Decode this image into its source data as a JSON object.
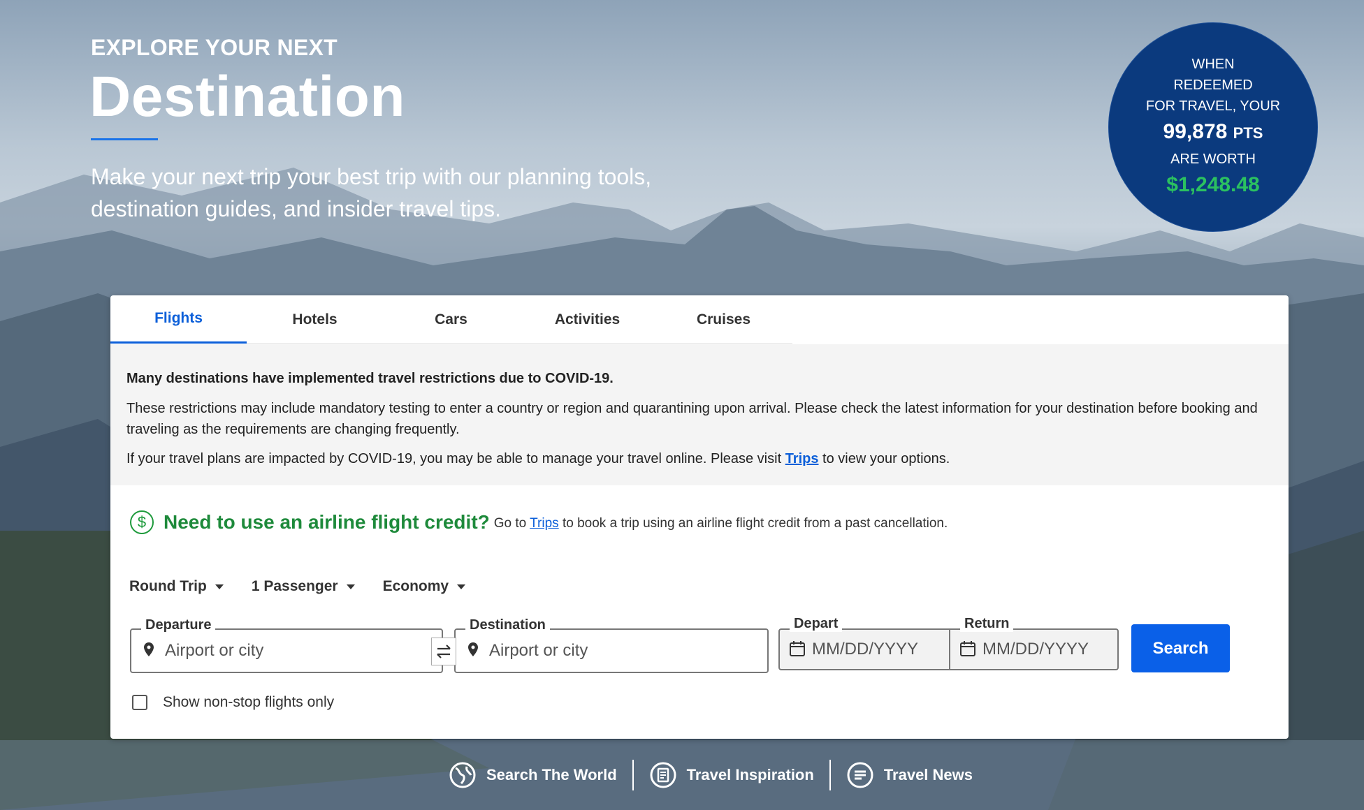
{
  "hero": {
    "kicker": "EXPLORE YOUR NEXT",
    "title": "Destination",
    "subtitle_line1": "Make your next trip your best trip with our planning tools,",
    "subtitle_line2": "destination guides, and insider travel tips."
  },
  "badge": {
    "line1": "WHEN",
    "line2": "REDEEMED",
    "line3": "FOR TRAVEL, YOUR",
    "points": "99,878",
    "points_unit": "PTS",
    "line4": "ARE WORTH",
    "value": "$1,248.48"
  },
  "tabs": [
    {
      "label": "Flights"
    },
    {
      "label": "Hotels"
    },
    {
      "label": "Cars"
    },
    {
      "label": "Activities"
    },
    {
      "label": "Cruises"
    }
  ],
  "notice": {
    "title": "Many destinations have implemented travel restrictions due to COVID-19.",
    "para1": "These restrictions may include mandatory testing to enter a country or region and quarantining upon arrival. Please check the latest information for your destination before booking and traveling as the requirements are changing frequently.",
    "para2_before": "If your travel plans are impacted by COVID-19, you may be able to manage your travel online. Please visit ",
    "para2_link": "Trips",
    "para2_after": " to view your options."
  },
  "credit": {
    "icon": "dollar-circle-icon",
    "heading": "Need to use an airline flight credit?",
    "text_before": "Go to ",
    "link": "Trips",
    "text_after": " to book a trip using an airline flight credit from a past cancellation."
  },
  "selectors": {
    "trip_type": "Round Trip",
    "passengers": "1 Passenger",
    "cabin": "Economy"
  },
  "fields": {
    "departure_label": "Departure",
    "departure_placeholder": "Airport or city",
    "destination_label": "Destination",
    "destination_placeholder": "Airport or city",
    "depart_label": "Depart",
    "depart_placeholder": "MM/DD/YYYY",
    "return_label": "Return",
    "return_placeholder": "MM/DD/YYYY"
  },
  "search_label": "Search",
  "nonstop_label": "Show non-stop flights only",
  "bottom_links": {
    "world": "Search The World",
    "inspiration": "Travel Inspiration",
    "news": "Travel News"
  },
  "colors": {
    "accent": "#0a60e8",
    "badge_bg": "#0b3a7e",
    "badge_value": "#2bc160",
    "credit_green": "#1e8a3b"
  }
}
